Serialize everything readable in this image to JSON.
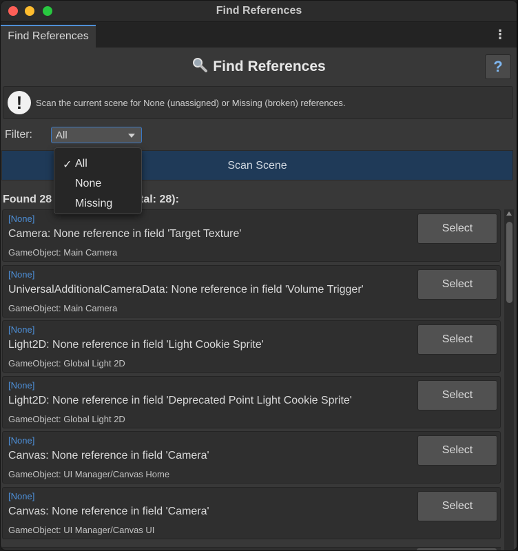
{
  "window": {
    "title": "Find References"
  },
  "tab": {
    "label": "Find References",
    "menu_icon": "kebab-menu-icon"
  },
  "header": {
    "title": "Find References",
    "icon": "magnifier-icon",
    "help_label": "?"
  },
  "info": {
    "icon": "exclamation-icon",
    "text": "Scan the current scene for None (unassigned) or Missing (broken) references."
  },
  "filter": {
    "label": "Filter:",
    "selected": "All",
    "options": [
      {
        "label": "All",
        "checked": "✓"
      },
      {
        "label": "None",
        "checked": ""
      },
      {
        "label": "Missing",
        "checked": ""
      }
    ]
  },
  "scan_button": {
    "label": "Scan Scene"
  },
  "found": {
    "prefix": "Found 28",
    "suffix": "tal: 28):"
  },
  "results": [
    {
      "tag": "[None]",
      "message": "Camera: None reference in field 'Target Texture'",
      "object": "GameObject: Main Camera",
      "button": "Select"
    },
    {
      "tag": "[None]",
      "message": "UniversalAdditionalCameraData: None reference in field 'Volume Trigger'",
      "object": "GameObject: Main Camera",
      "button": "Select"
    },
    {
      "tag": "[None]",
      "message": "Light2D: None reference in field 'Light Cookie Sprite'",
      "object": "GameObject: Global Light 2D",
      "button": "Select"
    },
    {
      "tag": "[None]",
      "message": "Light2D: None reference in field 'Deprecated Point Light Cookie Sprite'",
      "object": "GameObject: Global Light 2D",
      "button": "Select"
    },
    {
      "tag": "[None]",
      "message": "Canvas: None reference in field 'Camera'",
      "object": "GameObject: UI Manager/Canvas Home",
      "button": "Select"
    },
    {
      "tag": "[None]",
      "message": "Canvas: None reference in field 'Camera'",
      "object": "GameObject: UI Manager/Canvas UI",
      "button": "Select"
    }
  ],
  "colors": {
    "accent": "#4d8fd8",
    "scan_button": "#1f3a58",
    "panel": "#383838"
  }
}
